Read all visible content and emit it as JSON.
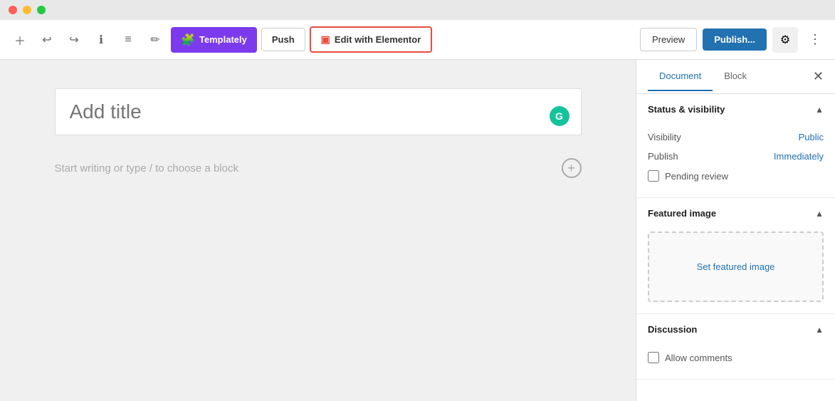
{
  "titleBar": {
    "trafficLights": [
      "red",
      "yellow",
      "green"
    ]
  },
  "toolbar": {
    "undoLabel": "↩",
    "redoLabel": "↪",
    "infoLabel": "ℹ",
    "listLabel": "≡",
    "penLabel": "✏",
    "temeplatelyLabel": "Templately",
    "pushLabel": "Push",
    "elementorLabel": "Edit with Elementor",
    "previewLabel": "Preview",
    "publishLabel": "Publish...",
    "settingsLabel": "⚙",
    "moreLabel": "⋮"
  },
  "editor": {
    "titlePlaceholder": "Add title",
    "contentPlaceholder": "Start writing or type / to choose a block"
  },
  "sidebar": {
    "tabs": [
      {
        "label": "Document",
        "active": true
      },
      {
        "label": "Block",
        "active": false
      }
    ],
    "sections": {
      "statusVisibility": {
        "title": "Status & visibility",
        "visibility": {
          "label": "Visibility",
          "value": "Public"
        },
        "publish": {
          "label": "Publish",
          "value": "Immediately"
        },
        "pendingReview": {
          "label": "Pending review",
          "checked": false
        }
      },
      "featuredImage": {
        "title": "Featured image",
        "setLabel": "Set featured image"
      },
      "discussion": {
        "title": "Discussion",
        "allowComments": {
          "label": "Allow comments",
          "checked": false
        }
      }
    }
  }
}
